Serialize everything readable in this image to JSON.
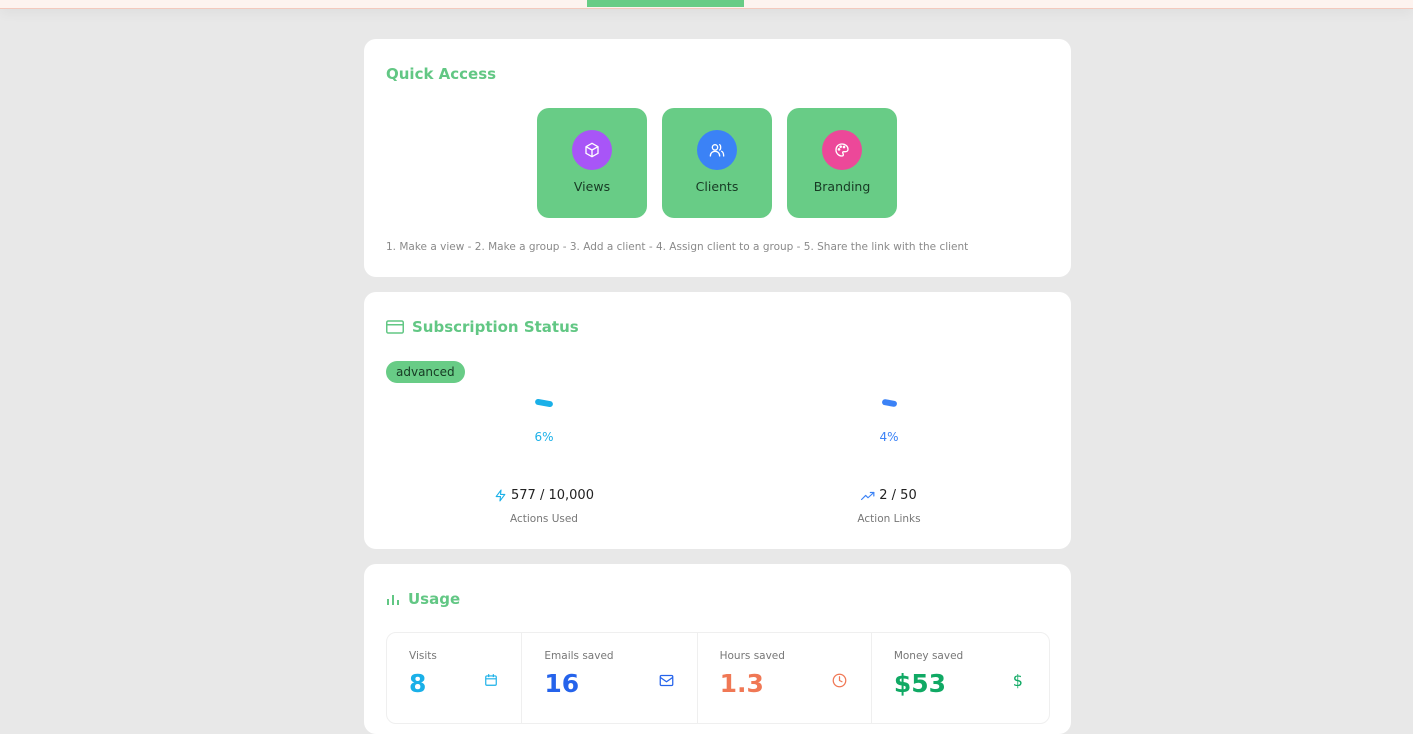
{
  "quick_access": {
    "title": "Quick Access",
    "tiles": [
      {
        "label": "Views",
        "icon": "cube-icon",
        "color": "#a855f7"
      },
      {
        "label": "Clients",
        "icon": "users-icon",
        "color": "#3b82f6"
      },
      {
        "label": "Branding",
        "icon": "palette-icon",
        "color": "#ec4899"
      }
    ],
    "steps": "1. Make a view - 2. Make a group - 3. Add a client - 4. Assign client to a group - 5. Share the link with the client"
  },
  "subscription": {
    "title": "Subscription Status",
    "plan": "advanced",
    "gauges": [
      {
        "percent": "6%",
        "value": "577 / 10,000",
        "label": "Actions Used",
        "icon": "lightning-icon",
        "color": "#1ab0e8"
      },
      {
        "percent": "4%",
        "value": "2 / 50",
        "label": "Action Links",
        "icon": "trending-up-icon",
        "color": "#3b82f6"
      }
    ]
  },
  "usage": {
    "title": "Usage",
    "stats": [
      {
        "label": "Visits",
        "value": "8",
        "icon": "calendar-icon",
        "color": "#1ab0e8"
      },
      {
        "label": "Emails saved",
        "value": "16",
        "icon": "mail-icon",
        "color": "#2563eb"
      },
      {
        "label": "Hours saved",
        "value": "1.3",
        "icon": "clock-icon",
        "color": "#f07855"
      },
      {
        "label": "Money saved",
        "value": "$53",
        "icon": "dollar-icon",
        "color": "#10a964"
      }
    ]
  }
}
